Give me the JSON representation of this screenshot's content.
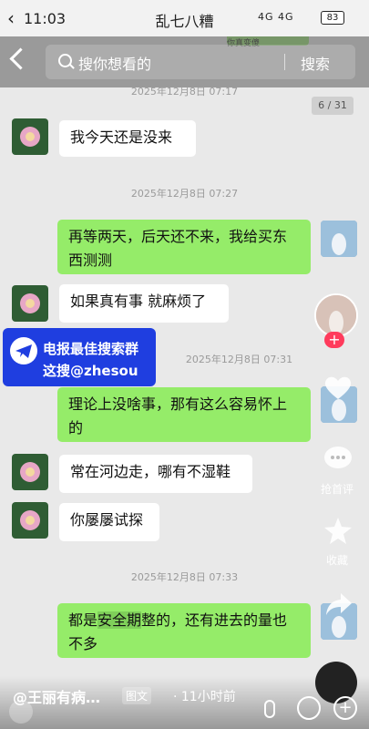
{
  "status": {
    "time": "11:03",
    "title": "乱七八糟",
    "signal": "4G 4G",
    "battery": "83"
  },
  "search": {
    "placeholder": "搜你想看的",
    "button": "搜索"
  },
  "peek_text": "你真变傻",
  "pager": "6 / 31",
  "timestamps": [
    "2025年12月8日 07:17",
    "2025年12月8日 07:27",
    "2025年12月8日 07:31",
    "2025年12月8日 07:33"
  ],
  "messages": [
    {
      "text": "我今天还是没来"
    },
    {
      "text": "再等两天，后天还不来，我给买东西测测"
    },
    {
      "text": "如果真有事  就麻烦了"
    },
    {
      "text": "理论上没啥事，那有这么容易怀上的"
    },
    {
      "text": "常在河边走，哪有不湿鞋"
    },
    {
      "text": "你屡屡试探"
    },
    {
      "pre": "都是",
      "hl": "安全期",
      "post": "整的，还有进去的量也不多"
    }
  ],
  "promo": {
    "line1": "电报最佳搜索群",
    "line2": "这搜@zhesou"
  },
  "rail": {
    "comment": "抢首评",
    "fav": "收藏"
  },
  "bottom": {
    "author": "@王丽有病…",
    "tag": "图文",
    "ago": "· 11小时前"
  },
  "colors": {
    "accent_green": "#95ec69",
    "promo_blue": "#1f3ee0",
    "like_red": "#ff3b5c"
  }
}
